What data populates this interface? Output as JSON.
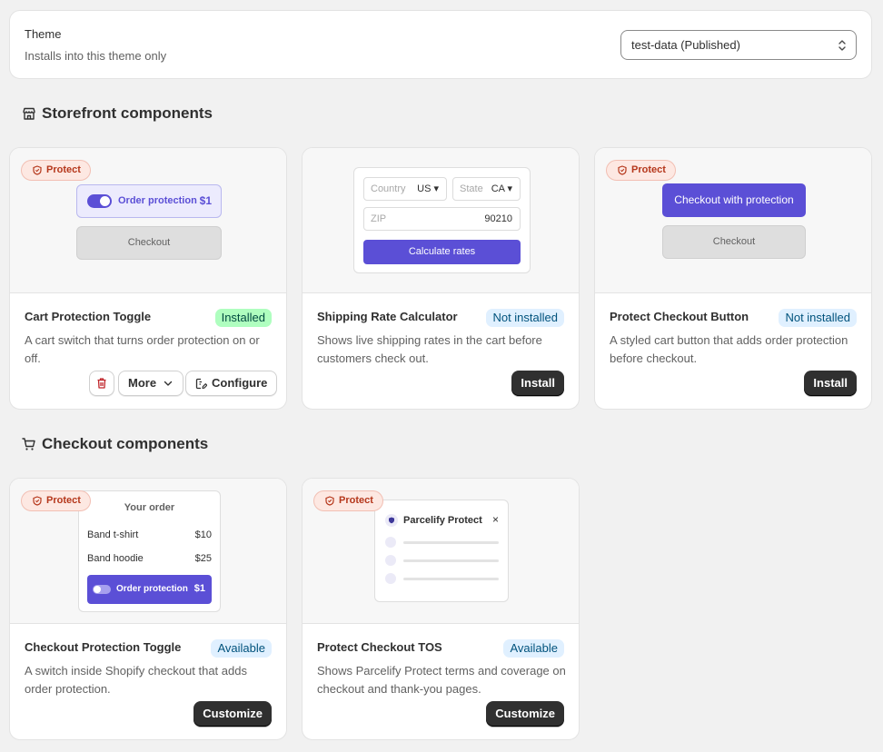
{
  "theme": {
    "title": "Theme",
    "subtitle": "Installs into this theme only",
    "selected": "test-data (Published)"
  },
  "storefront": {
    "heading": "Storefront components",
    "icon": "store-icon",
    "cards": [
      {
        "name": "Cart Protection Toggle",
        "badge": "Installed",
        "description": "A cart switch that turns order protection on or off.",
        "tag": "Protect",
        "preview": {
          "toggle_label": "Order protection",
          "price": "$1",
          "checkout": "Checkout"
        },
        "actions": {
          "more": "More",
          "configure": "Configure"
        }
      },
      {
        "name": "Shipping Rate Calculator",
        "badge": "Not installed",
        "description": "Shows live shipping rates in the cart before customers check out.",
        "preview": {
          "country_label": "Country",
          "country_value": "US",
          "state_label": "State",
          "state_value": "CA",
          "zip_label": "ZIP",
          "zip_value": "90210",
          "button": "Calculate rates"
        },
        "action": "Install"
      },
      {
        "name": "Protect Checkout Button",
        "badge": "Not installed",
        "description": "A styled cart button that adds order protection before checkout.",
        "tag": "Protect",
        "preview": {
          "primary": "Checkout with protection",
          "secondary": "Checkout"
        },
        "action": "Install"
      }
    ]
  },
  "checkout": {
    "heading": "Checkout components",
    "icon": "cart-icon",
    "cards": [
      {
        "name": "Checkout Protection Toggle",
        "badge": "Available",
        "description": "A switch inside Shopify checkout that adds order protection.",
        "tag": "Protect",
        "preview": {
          "title": "Your order",
          "items": [
            {
              "name": "Band t-shirt",
              "price": "$10"
            },
            {
              "name": "Band hoodie",
              "price": "$25"
            }
          ],
          "protection_label": "Order protection",
          "protection_price": "$1"
        },
        "action": "Customize"
      },
      {
        "name": "Protect Checkout TOS",
        "badge": "Available",
        "description": "Shows Parcelify Protect terms and coverage on checkout and thank-you pages.",
        "tag": "Protect",
        "preview": {
          "title": "Parcelify Protect",
          "close": "×"
        },
        "action": "Customize"
      }
    ]
  },
  "colors": {
    "accent": "#5b4fd6",
    "installed_badge": "#affebf",
    "info_badge": "#e0f0ff",
    "protect_tag": "#fde8e2"
  }
}
